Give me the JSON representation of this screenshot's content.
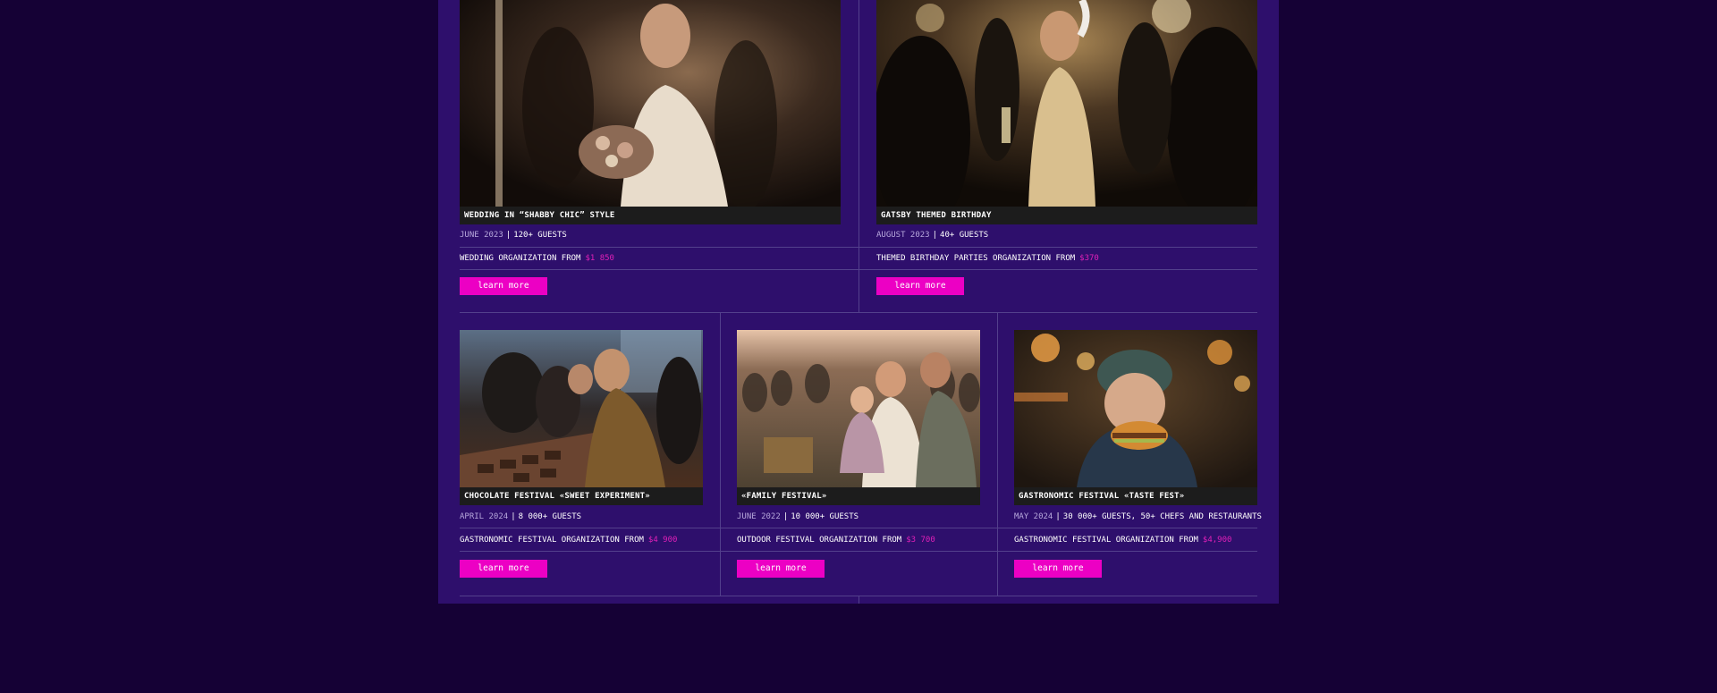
{
  "colors": {
    "page_bg": "#150135",
    "panel_bg": "#2e0f6c",
    "accent": "#ec00c4",
    "price_accent": "#e020b8",
    "caption_bg": "#1c1c1c",
    "divider": "#53408c"
  },
  "events": [
    {
      "title": "WEDDING IN “SHABBY CHIC” STYLE",
      "date": "JUNE 2023",
      "guests": "120+ GUESTS",
      "service": "WEDDING ORGANIZATION FROM",
      "price": "$1 850",
      "button": "learn more",
      "image_icon": "wedding-photo"
    },
    {
      "title": "GATSBY THEMED BIRTHDAY",
      "date": "AUGUST 2023",
      "guests": "40+ GUESTS",
      "service": "THEMED BIRTHDAY PARTIES ORGANIZATION FROM",
      "price": "$370",
      "button": "learn more",
      "image_icon": "gatsby-party-photo"
    },
    {
      "title": "CHOCOLATE FESTIVAL «SWEET EXPERIMENT»",
      "date": "APRIL 2024",
      "guests": "8 000+ GUESTS",
      "service": "GASTRONOMIC FESTIVAL ORGANIZATION FROM",
      "price": "$4 900",
      "button": "learn more",
      "image_icon": "chocolate-festival-photo"
    },
    {
      "title": "«FAMILY FESTIVAL»",
      "date": "JUNE 2022",
      "guests": "10 000+ GUESTS",
      "service": "OUTDOOR FESTIVAL ORGANIZATION FROM",
      "price": "$3 700",
      "button": "learn more",
      "image_icon": "family-festival-photo"
    },
    {
      "title": "GASTRONOMIC FESTIVAL «TASTE FEST»",
      "date": "MAY 2024",
      "guests": "30 000+ GUESTS, 50+ CHEFS AND RESTAURANTS",
      "service": "GASTRONOMIC FESTIVAL ORGANIZATION FROM",
      "price": "$4,900",
      "button": "learn more",
      "image_icon": "taste-fest-photo"
    }
  ]
}
